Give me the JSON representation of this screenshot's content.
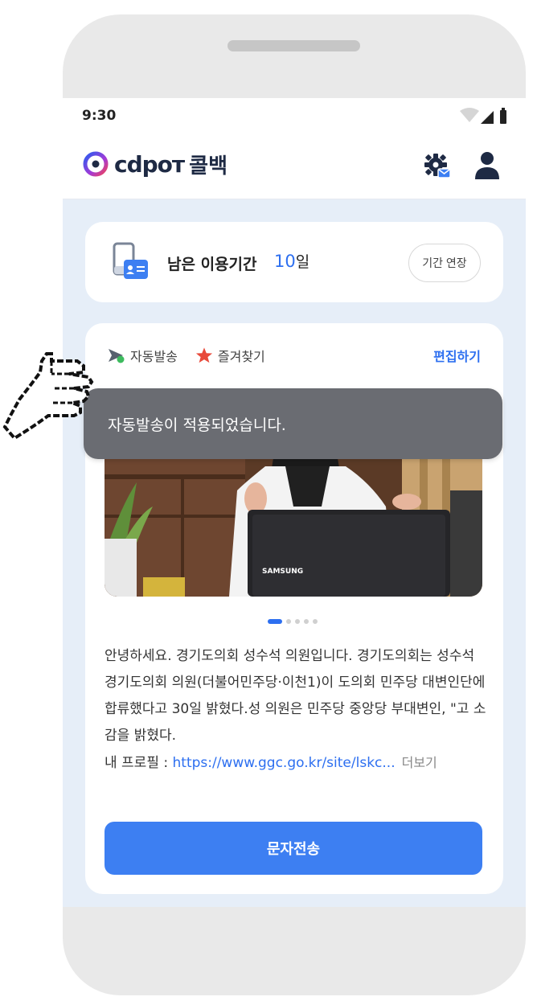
{
  "status_bar": {
    "time": "9:30"
  },
  "app_bar": {
    "logo_text": "cdpoт",
    "logo_subtitle": "콜백",
    "settings_icon": "gear-mail-icon",
    "profile_icon": "user-icon"
  },
  "subscription": {
    "label": "남은 이용기간",
    "days_value": "10",
    "days_unit": "일",
    "extend_label": "기간 연장",
    "icon": "phone-card-icon"
  },
  "post": {
    "tabs": [
      {
        "label": "자동발송",
        "icon": "send-check-icon"
      },
      {
        "label": "즐겨찾기",
        "icon": "star-icon"
      }
    ],
    "edit_label": "편집하기",
    "pager": {
      "total": 5,
      "active": 1
    },
    "description_text": "안녕하세요. 경기도의회 성수석 의원입니다. 경기도의회는 성수석 경기도의회 의원(더불어민주당·이천1)이 도의회 민주당 대변인단에 합류했다고 30일 밝혔다.성 의원은 민주당 중앙당 부대변인, \"고 소감을 밝혔다.",
    "profile_prefix": "내 프로필 : ",
    "profile_link": "https://www.ggc.go.kr/site/lskc...",
    "more_label": "더보기",
    "photo_brand": "SAMSUNG",
    "send_label": "문자전송"
  },
  "toast": {
    "message": "자동발송이 적용되었습니다."
  },
  "colors": {
    "accent": "#2d6ff0",
    "button": "#3d7ff2",
    "toast": "#6a6c72",
    "star": "#e8493a"
  }
}
